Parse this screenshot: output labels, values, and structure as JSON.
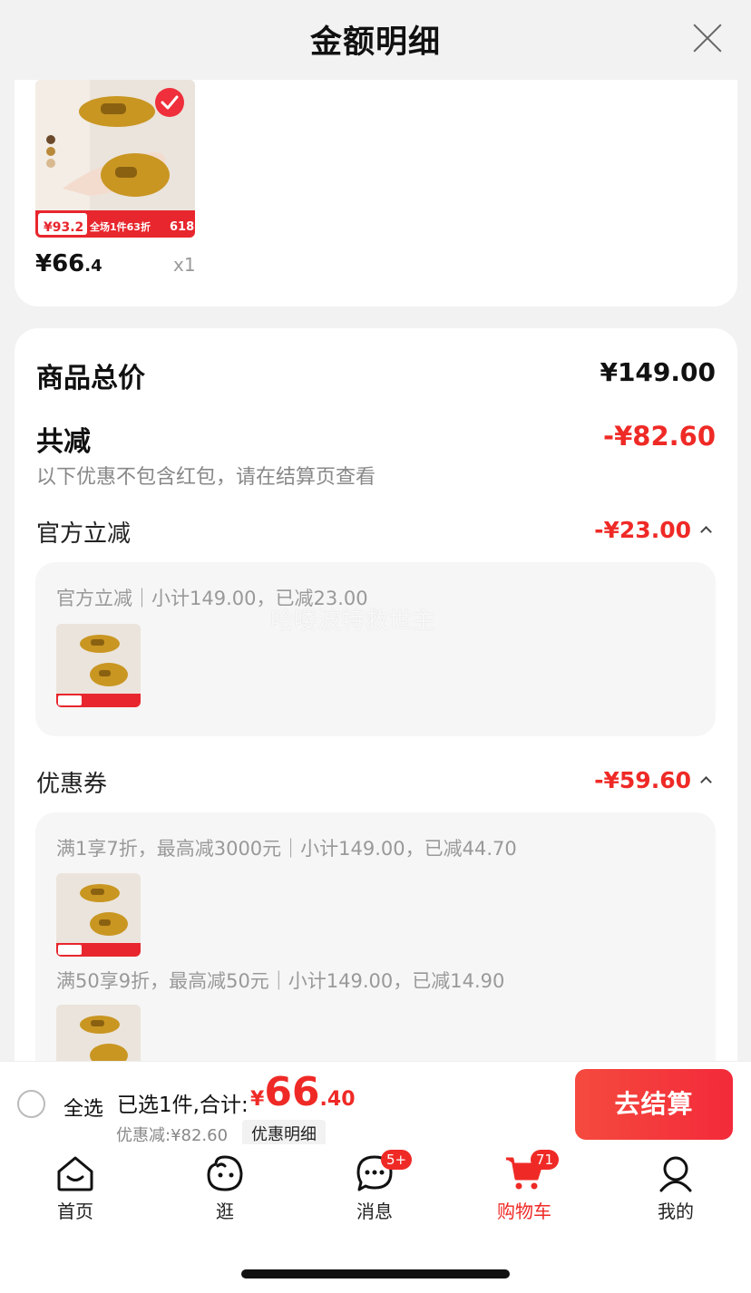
{
  "header": {
    "title": "金额明细"
  },
  "product": {
    "price_int": "¥66",
    "price_dec": ".4",
    "qty": "x1"
  },
  "summary": {
    "total_label": "商品总价",
    "total_value": "¥149.00",
    "reduce_label": "共减",
    "reduce_value": "-¥82.60",
    "note": "以下优惠不包含红包，请在结算页查看"
  },
  "official": {
    "title": "官方立减",
    "amount": "-¥23.00",
    "line": "官方立减｜小计149.00，已减23.00"
  },
  "coupon": {
    "title": "优惠券",
    "amount": "-¥59.60",
    "line1": "满1享7折，最高减3000元｜小计149.00，已减44.70",
    "line2": "满50享9折，最高减50元｜小计149.00，已减14.90"
  },
  "watermark": "哈喽波特救世主",
  "bottom": {
    "select_all": "全选",
    "selected": "已选1件,合计:",
    "yen": "¥",
    "price_int": "66",
    "price_dec": ".40",
    "saved": "优惠减:¥82.60",
    "detail_link": "优惠明细",
    "checkout": "去结算"
  },
  "tabs": [
    {
      "label": "首页",
      "icon": "home-icon"
    },
    {
      "label": "逛",
      "icon": "browse-icon"
    },
    {
      "label": "消息",
      "icon": "message-icon",
      "badge": "5+"
    },
    {
      "label": "购物车",
      "icon": "cart-icon",
      "badge": "71"
    },
    {
      "label": "我的",
      "icon": "profile-icon"
    }
  ],
  "colors": {
    "accent": "#ef2a26",
    "background": "#f2f2f2"
  }
}
